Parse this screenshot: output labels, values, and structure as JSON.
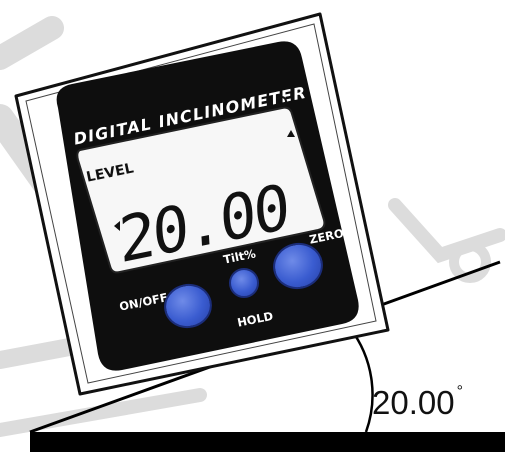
{
  "device": {
    "title": "DIGITAL INCLINOMETER",
    "lcd": {
      "mode": "LEVEL",
      "reading": "20.00"
    },
    "buttons": {
      "on_off": "ON/OFF",
      "tilt": "Tilt%",
      "hold": "HOLD",
      "zero": "ZERO"
    }
  },
  "angle_label": {
    "value": "20.00",
    "unit": "°"
  },
  "colors": {
    "button_blue": "#3a5cd0",
    "body_black": "#0e0e0e",
    "lcd_background": "#f7f7f7",
    "watermark_grey": "#dcdcdc"
  }
}
